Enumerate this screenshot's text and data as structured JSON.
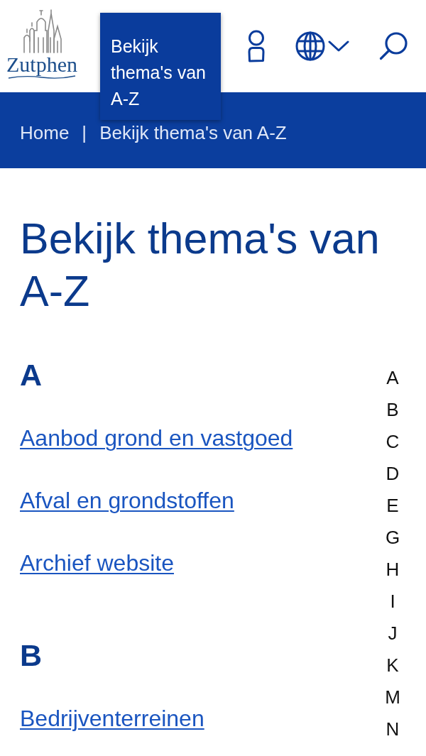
{
  "header": {
    "logo": {
      "text": "Zutphen"
    },
    "menu_panel": {
      "label": "Bekijk thema's van A-Z"
    }
  },
  "breadcrumb": {
    "items": [
      "Home",
      "Bekijk thema's van A-Z"
    ],
    "separator": "|"
  },
  "page_title": "Bekijk thema's van A-Z",
  "sections": [
    {
      "letter": "A",
      "links": [
        "Aanbod grond en vastgoed",
        "Afval en grondstoffen",
        "Archief website"
      ]
    },
    {
      "letter": "B",
      "links": [
        "Bedrijventerreinen"
      ]
    }
  ],
  "letter_index": [
    "A",
    "B",
    "C",
    "D",
    "E",
    "G",
    "H",
    "I",
    "J",
    "K",
    "M",
    "N"
  ]
}
